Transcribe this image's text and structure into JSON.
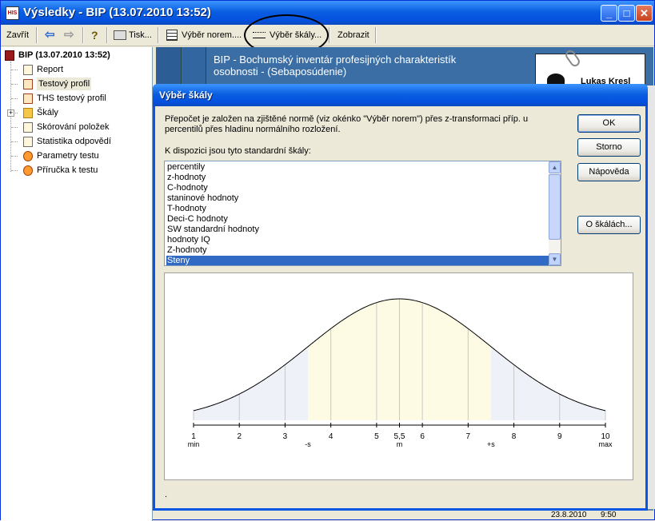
{
  "window": {
    "title": "Výsledky - BIP (13.07.2010 13:52)",
    "icon_text": "HIS"
  },
  "toolbar": {
    "close_label": "Zavřít",
    "print_label": "Tisk...",
    "norms_label": "Výběr norem....",
    "scales_label": "Výběr škály...",
    "show_label": "Zobrazit",
    "help_icon": "?"
  },
  "tree": {
    "root": "BIP (13.07.2010 13:52)",
    "items": [
      {
        "label": "Report",
        "icon": "doc-icon"
      },
      {
        "label": "Testový profil",
        "icon": "doc-red-icon",
        "selected": true
      },
      {
        "label": "THS testový profil",
        "icon": "doc-red-icon"
      },
      {
        "label": "Škály",
        "icon": "folder-icon",
        "expandable": true
      },
      {
        "label": "Skórování položek",
        "icon": "doc-icon"
      },
      {
        "label": "Statistika odpovědí",
        "icon": "doc-icon"
      },
      {
        "label": "Parametry testu",
        "icon": "gear-icon"
      },
      {
        "label": "Příručka k testu",
        "icon": "gear-icon"
      }
    ]
  },
  "background": {
    "header_text": "BIP - Bochumský inventár profesijných charakteristík osobnosti - (Sebaposúdenie)",
    "person_name": "Lukas Kresl",
    "status_date": "23.8.2010",
    "status_time": "9:50"
  },
  "dialog": {
    "title": "Výběr škály",
    "description": "Přepočet je založen na zjištěné normě (viz okénko \"Výběr norem\") přes z-transformaci příp. u percentilů přes hladinu normálního rozložení.",
    "available_label": "K dispozici jsou tyto standardní škály:",
    "scales": [
      "percentily",
      "z-hodnoty",
      "C-hodnoty",
      "staninové hodnoty",
      "T-hodnoty",
      "Deci-C hodnoty",
      "SW standardní hodnoty",
      "hodnoty IQ",
      "Z-hodnoty",
      "Steny"
    ],
    "selected_scale": "Steny",
    "buttons": {
      "ok": "OK",
      "cancel": "Storno",
      "help": "Nápověda",
      "about": "O škálách..."
    },
    "bottom_text": "."
  },
  "chart_data": {
    "type": "area",
    "x_ticks": [
      "1",
      "2",
      "3",
      "4",
      "5",
      "5,5",
      "6",
      "7",
      "8",
      "9",
      "10"
    ],
    "x_values": [
      1,
      2,
      3,
      4,
      5,
      5.5,
      6,
      7,
      8,
      9,
      10
    ],
    "x_sublabels": [
      {
        "x": 1,
        "text": "min"
      },
      {
        "x": 3.5,
        "text": "-s"
      },
      {
        "x": 5.5,
        "text": "m"
      },
      {
        "x": 7.5,
        "text": "+s"
      },
      {
        "x": 10,
        "text": "max"
      }
    ],
    "xlim": [
      1,
      10
    ],
    "mean": 5.5,
    "sd": 2,
    "regions": [
      {
        "from": 1,
        "to": 3.5,
        "color": "#eef1f7"
      },
      {
        "from": 3.5,
        "to": 7.5,
        "color": "#fdfbe3"
      },
      {
        "from": 7.5,
        "to": 10,
        "color": "#eef1f7"
      }
    ],
    "curve_color": "#000000",
    "grid": true,
    "title": "",
    "xlabel": "",
    "ylabel": ""
  }
}
